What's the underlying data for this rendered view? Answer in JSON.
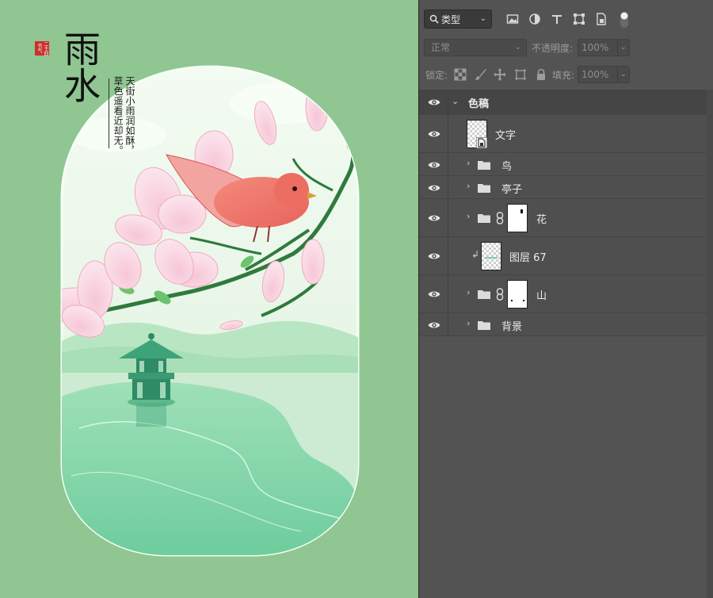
{
  "canvas": {
    "background": "#8fc692",
    "seal_text": "二十四节气",
    "title": "雨水",
    "poem_line1": "天街小雨润如酥，",
    "poem_line2": "草色遥看近却无。"
  },
  "panel": {
    "filter": {
      "kind_label": "类型",
      "icons": [
        "image-filter-icon",
        "adjustment-filter-icon",
        "type-filter-icon",
        "shape-filter-icon",
        "smart-object-filter-icon",
        "filter-toggle-icon"
      ]
    },
    "blend": {
      "mode": "正常",
      "opacity_label": "不透明度:",
      "opacity_value": "100%"
    },
    "lock": {
      "label": "锁定:",
      "fill_label": "填充:",
      "fill_value": "100%",
      "icons": [
        "lock-transparent-icon",
        "lock-paint-icon",
        "lock-move-icon",
        "lock-artboard-icon",
        "lock-all-icon"
      ]
    },
    "layers": [
      {
        "name": "色稿",
        "type": "group-open"
      },
      {
        "name": "文字",
        "type": "smart-object"
      },
      {
        "name": "鸟",
        "type": "group"
      },
      {
        "name": "亭子",
        "type": "group"
      },
      {
        "name": "花",
        "type": "group-mask"
      },
      {
        "name": "图层 67",
        "type": "clipped-layer"
      },
      {
        "name": "山",
        "type": "group-mask"
      },
      {
        "name": "背景",
        "type": "group"
      }
    ]
  }
}
